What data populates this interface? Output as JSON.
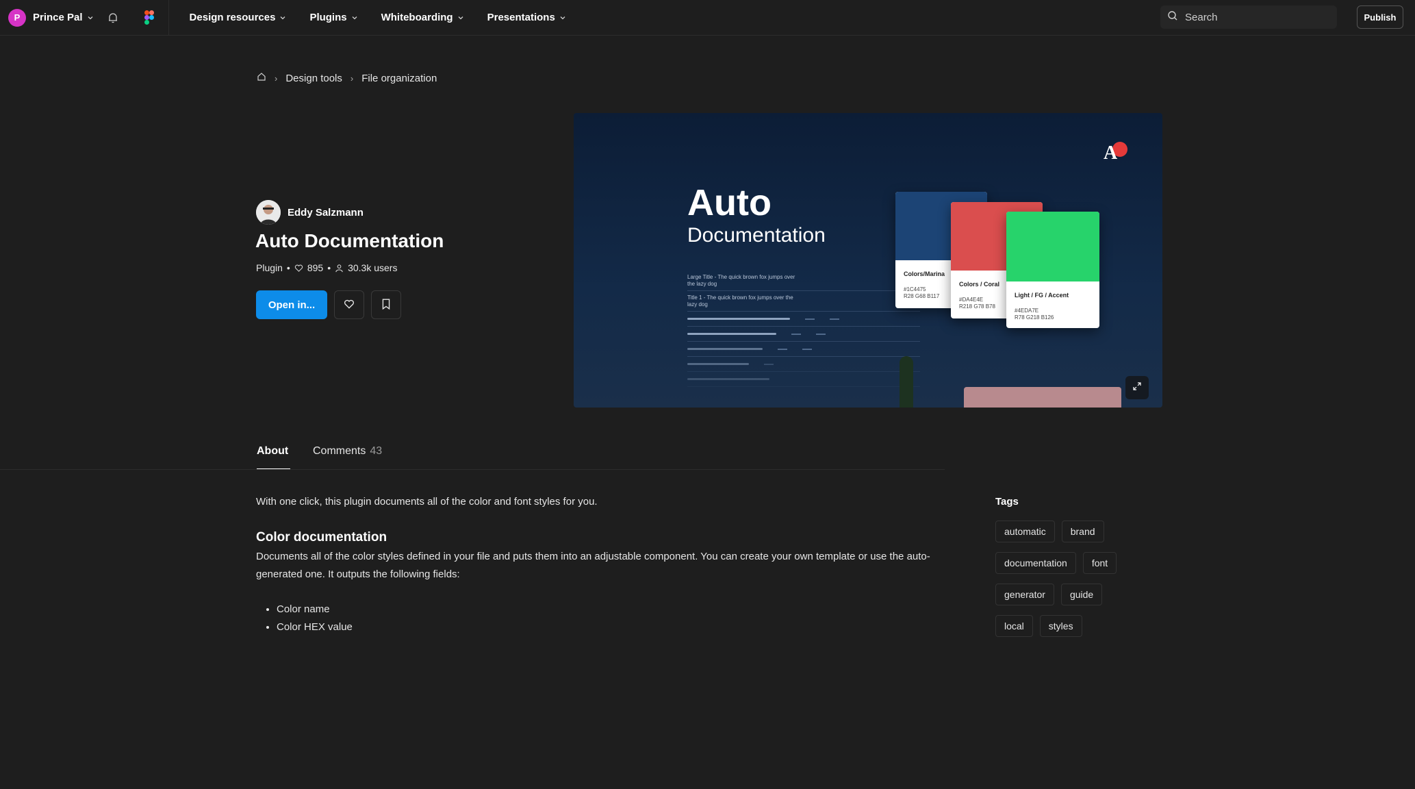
{
  "topnav": {
    "user_initial": "P",
    "user_name": "Prince Pal",
    "menu": [
      "Design resources",
      "Plugins",
      "Whiteboarding",
      "Presentations"
    ],
    "search_placeholder": "Search",
    "publish_label": "Publish"
  },
  "breadcrumb": {
    "items": [
      "Design tools",
      "File organization"
    ]
  },
  "plugin": {
    "author": "Eddy Salzmann",
    "title": "Auto Documentation",
    "type": "Plugin",
    "likes": "895",
    "users": "30.3k users",
    "open_label": "Open in..."
  },
  "hero": {
    "title_line1": "Auto",
    "title_line2": "Documentation",
    "row_labels": [
      "Large Title - The quick brown fox jumps over the lazy dog",
      "Title 1 - The quick brown fox jumps over the lazy dog"
    ],
    "cards": [
      {
        "name": "Colors/Marina",
        "hex": "#1C4475",
        "rgb": "R28 G68 B117",
        "color": "#1c4475"
      },
      {
        "name": "Colors / Coral",
        "hex": "#DA4E4E",
        "rgb": "R218 G78 B78",
        "color": "#da4e4e"
      },
      {
        "name": "Light / FG / Accent",
        "hex": "#4EDA7E",
        "rgb": "R78 G218 B126",
        "color": "#27d36b"
      }
    ]
  },
  "tabs": {
    "about": "About",
    "comments": "Comments",
    "comments_count": "43"
  },
  "about": {
    "intro": "With one click, this plugin documents all of the color and font styles for you.",
    "heading": "Color documentation",
    "paragraph": "Documents all of the color styles defined in your file and puts them into an adjustable component. You can create your own template or use the auto-generated one. It outputs the following fields:",
    "bullets": [
      "Color name",
      "Color HEX value"
    ]
  },
  "tags": {
    "heading": "Tags",
    "items": [
      "automatic",
      "brand",
      "documentation",
      "font",
      "generator",
      "guide",
      "local",
      "styles"
    ]
  },
  "colors": {
    "accent_blue": "#0d8ce9",
    "avatar_pink": "#d633c6",
    "background": "#1e1e1e"
  }
}
